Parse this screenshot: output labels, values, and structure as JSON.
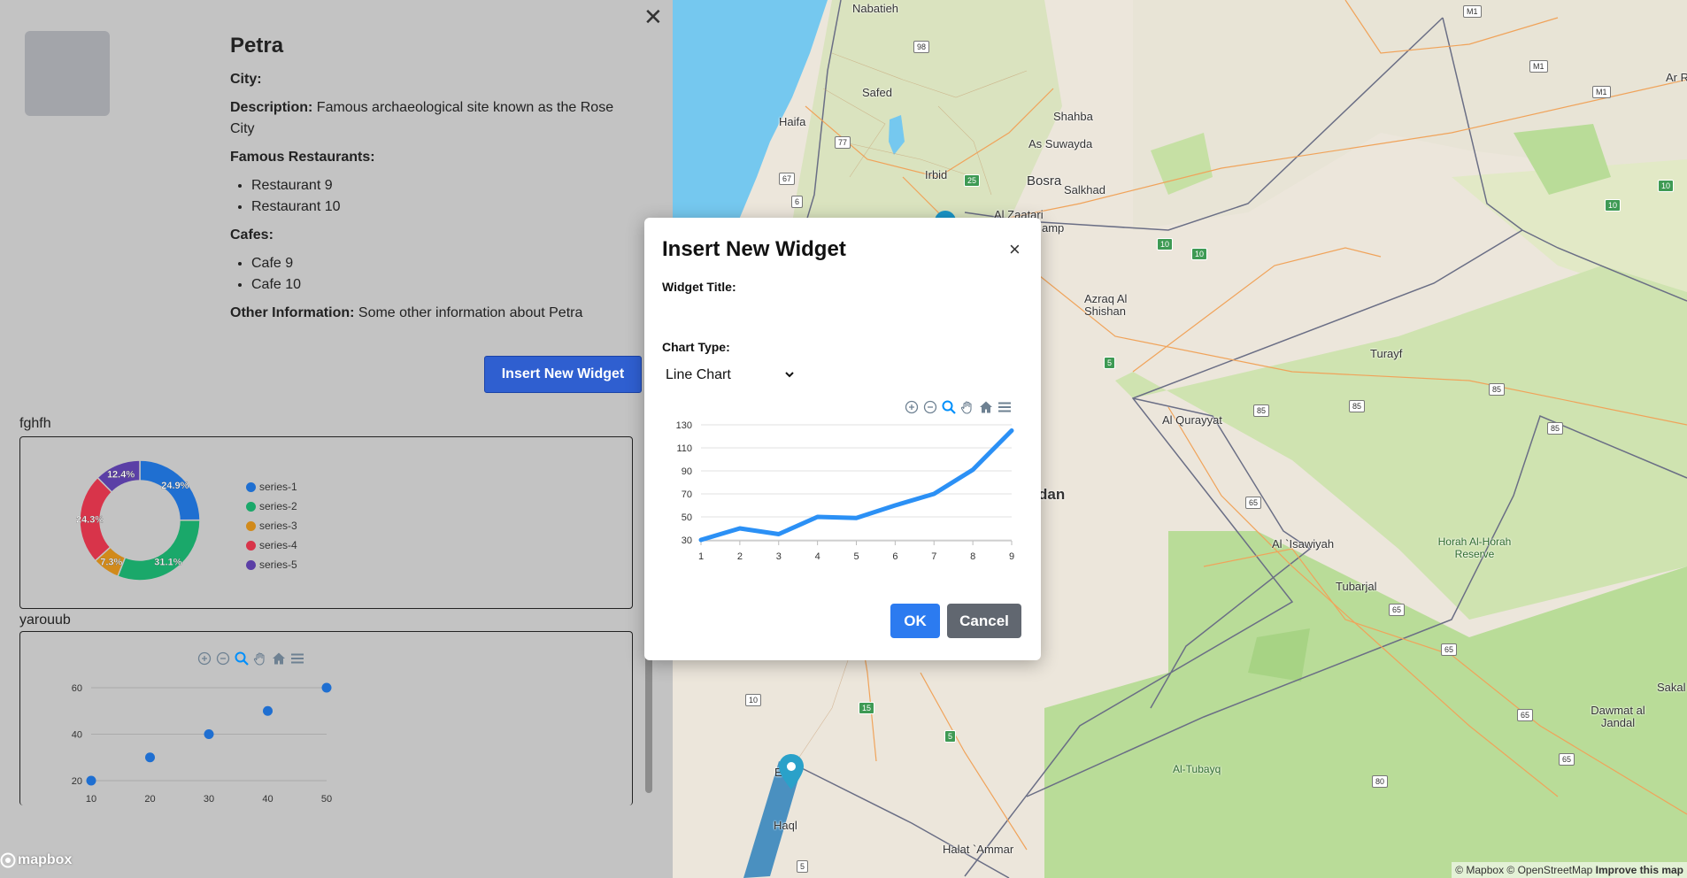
{
  "map": {
    "attribution": "© Mapbox © OpenStreetMap",
    "improve": "Improve this map",
    "places": [
      {
        "name": "Nabatieh",
        "big": false
      },
      {
        "name": "Safed",
        "big": false
      },
      {
        "name": "Haifa",
        "big": false
      },
      {
        "name": "Irbid",
        "big": false
      },
      {
        "name": "Shahba",
        "big": false
      },
      {
        "name": "As Suwayda",
        "big": false
      },
      {
        "name": "Bosra",
        "big": false
      },
      {
        "name": "Salkhad",
        "big": false
      },
      {
        "name": "Al Zaatari",
        "big": false
      },
      {
        "name": "Azraq Al Shishan",
        "big": false
      },
      {
        "name": "Turayf",
        "big": false
      },
      {
        "name": "Al Qurayyat",
        "big": false
      },
      {
        "name": "dan",
        "big": true
      },
      {
        "name": "Al `Isawiyah",
        "big": false
      },
      {
        "name": "Tubarjal",
        "big": false
      },
      {
        "name": "Horah Al-Horah Reserve",
        "big": false
      },
      {
        "name": "Al-Tubayq",
        "big": false
      },
      {
        "name": "Dawmat al Jandal",
        "big": false
      },
      {
        "name": "Haql",
        "big": false
      },
      {
        "name": "Halat `Ammar",
        "big": false
      },
      {
        "name": "Ar R",
        "big": false
      },
      {
        "name": "Sakal",
        "big": false
      },
      {
        "name": "amp",
        "big": false
      },
      {
        "name": "E",
        "big": false
      }
    ],
    "shields": [
      "M1",
      "M1",
      "M1",
      "98",
      "77",
      "67",
      "6",
      "25",
      "10",
      "10",
      "10",
      "10",
      "10",
      "5",
      "85",
      "85",
      "85",
      "85",
      "65",
      "65",
      "65",
      "65",
      "65",
      "80",
      "10",
      "15",
      "5",
      "5"
    ],
    "logo": "mapbox"
  },
  "panel": {
    "title": "Petra",
    "city_label": "City:",
    "city_value": "",
    "description_label": "Description:",
    "description_value": "Famous archaeological site known as the Rose City",
    "restaurants_label": "Famous Restaurants:",
    "restaurants": [
      "Restaurant 9",
      "Restaurant 10"
    ],
    "cafes_label": "Cafes:",
    "cafes": [
      "Cafe 9",
      "Cafe 10"
    ],
    "other_label": "Other Information:",
    "other_value": "Some other information about Petra",
    "insert_button": "Insert New Widget"
  },
  "widgets": [
    {
      "title": "fghfh",
      "chart_data": {
        "type": "pie",
        "labels": [
          "series-1",
          "series-2",
          "series-3",
          "series-4",
          "series-5"
        ],
        "values": [
          24.9,
          31.1,
          7.3,
          24.3,
          12.4
        ],
        "display_labels": [
          "24.9%",
          "31.1%",
          "7.3%",
          "24.3%",
          "12.4%"
        ],
        "colors": [
          "#1f6fd1",
          "#1aa86a",
          "#d18a1b",
          "#d8344a",
          "#5b3fa6"
        ]
      }
    },
    {
      "title": "yarouub",
      "chart_data": {
        "type": "scatter",
        "x": [
          10,
          20,
          30,
          40,
          50
        ],
        "y": [
          20,
          30,
          40,
          50,
          60
        ],
        "xticks": [
          "10",
          "20",
          "30",
          "40",
          "50"
        ],
        "yticks": [
          "20",
          "40",
          "60"
        ],
        "xlim": [
          10,
          50
        ],
        "ylim": [
          20,
          60
        ],
        "color": "#1f6fd1"
      }
    }
  ],
  "modal": {
    "title": "Insert New Widget",
    "close_glyph": "×",
    "widget_title_label": "Widget Title:",
    "chart_type_label": "Chart Type:",
    "chart_type_value": "Line Chart",
    "ok_label": "OK",
    "cancel_label": "Cancel",
    "chart_data": {
      "type": "line",
      "x": [
        1,
        2,
        3,
        4,
        5,
        6,
        7,
        8,
        9
      ],
      "y": [
        30,
        40,
        35,
        50,
        49,
        60,
        70,
        91,
        125
      ],
      "xticks": [
        "1",
        "2",
        "3",
        "4",
        "5",
        "6",
        "7",
        "8",
        "9"
      ],
      "yticks": [
        "30",
        "50",
        "70",
        "90",
        "110",
        "130"
      ],
      "xlim": [
        1,
        9
      ],
      "ylim": [
        30,
        130
      ],
      "color": "#2b90f5"
    }
  },
  "toolbar_icons": [
    "zoom-in-icon",
    "zoom-out-icon",
    "zoom-select-icon",
    "pan-hand-icon",
    "home-icon",
    "menu-icon"
  ]
}
